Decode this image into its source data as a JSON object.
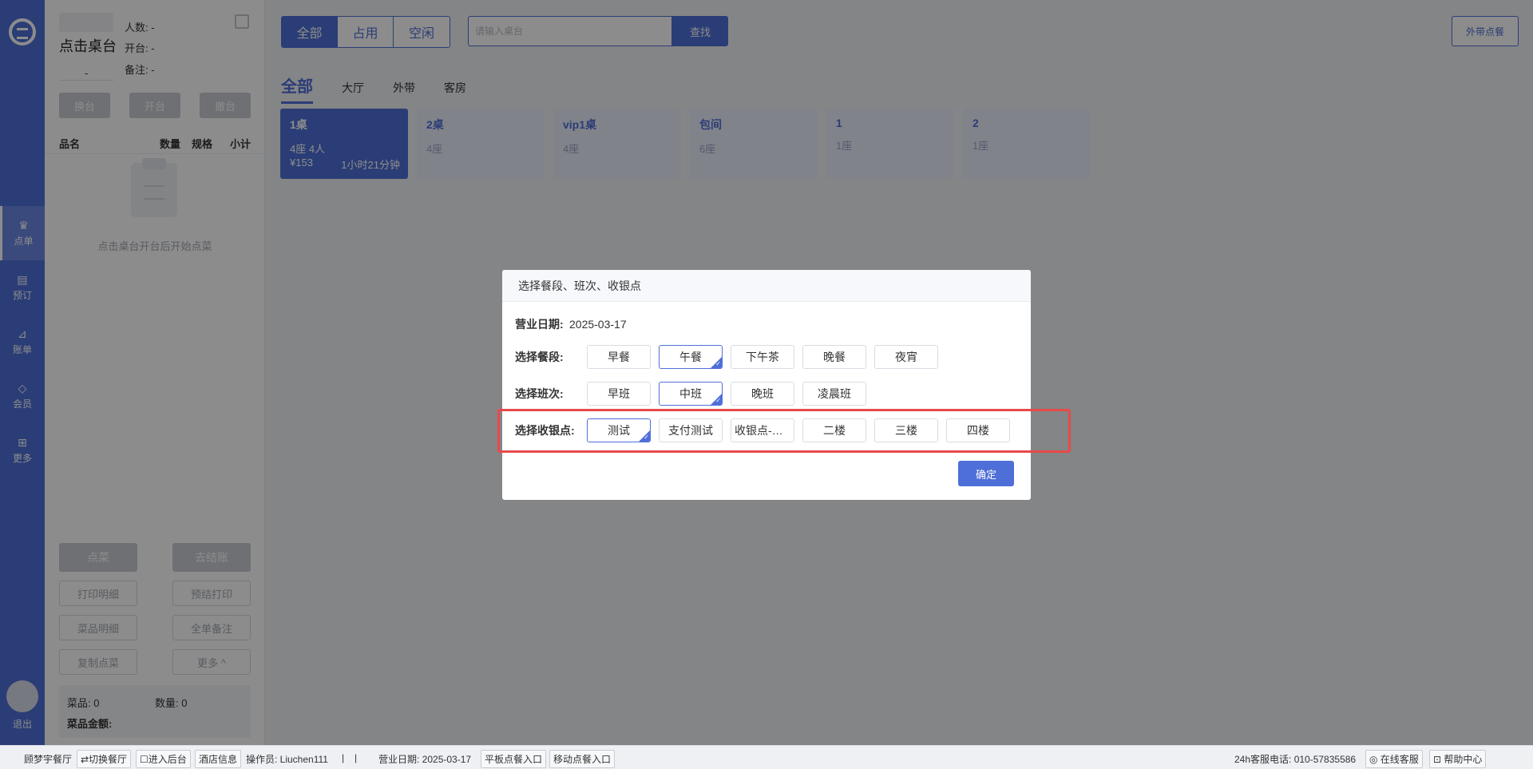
{
  "nav": {
    "items": [
      {
        "label": "点单",
        "icon": "chef-hat-icon"
      },
      {
        "label": "预订",
        "icon": "book-icon"
      },
      {
        "label": "账单",
        "icon": "chart-icon"
      },
      {
        "label": "会员",
        "icon": "diamond-icon"
      },
      {
        "label": "更多",
        "icon": "grid-icon"
      }
    ],
    "logout": "退出"
  },
  "order": {
    "title": "点击桌台",
    "dash": "-",
    "people": "人数: -",
    "open": "开台: -",
    "remark": "备注: -",
    "btns": [
      "换台",
      "开台",
      "撤台"
    ],
    "cols": {
      "name": "品名",
      "qty": "数量",
      "spec": "规格",
      "sub": "小计"
    },
    "empty": "点击桌台开台后开始点菜",
    "order_btn": "点菜",
    "checkout_btn": "去结账",
    "print_detail": "打印明细",
    "pre_print": "预结打印",
    "dish_detail": "菜品明细",
    "all_remark": "全单备注",
    "copy_dish": "复制点菜",
    "more": "更多 ^",
    "dish_count": "菜品:  0",
    "quantity": "数量:  0",
    "amount": "菜品金额:"
  },
  "top": {
    "seg": [
      "全部",
      "占用",
      "空闲"
    ],
    "search_placeholder": "请输入桌台",
    "search_btn": "查找",
    "takeout_btn": "外带点餐"
  },
  "areas": [
    "全部",
    "大厅",
    "外带",
    "客房"
  ],
  "tables": [
    {
      "name": "1桌",
      "seats": "4座   4人",
      "price": "¥153",
      "time": "1小时21分钟"
    },
    {
      "name": "2桌",
      "seats": "4座"
    },
    {
      "name": "vip1桌",
      "seats": "4座"
    },
    {
      "name": "包间",
      "seats": "6座"
    },
    {
      "name": "1",
      "seats": "1座"
    },
    {
      "name": "2",
      "seats": "1座"
    }
  ],
  "modal": {
    "title": "选择餐段、班次、收银点",
    "date_label": "营业日期:",
    "date_value": "2025-03-17",
    "meal_label": "选择餐段:",
    "meals": [
      "早餐",
      "午餐",
      "下午茶",
      "晚餐",
      "夜宵"
    ],
    "shift_label": "选择班次:",
    "shifts": [
      "早班",
      "中班",
      "晚班",
      "凌晨班"
    ],
    "cashier_label": "选择收银点:",
    "cashiers": [
      "测试",
      "支付测试",
      "收银点-消...",
      "二楼",
      "三楼",
      "四楼"
    ],
    "confirm": "确定",
    "selected_meal": "午餐",
    "selected_shift": "中班",
    "selected_cashier": "测试"
  },
  "status": {
    "restaurant": "顾梦宇餐厅",
    "switch": "⇄切换餐厅",
    "backend": "☐进入后台",
    "hotel": "酒店信息",
    "operator": "操作员: Liuchen111",
    "sep1": "|",
    "sep2": "|",
    "biz_date": "营业日期: 2025-03-17",
    "tablet": "平板点餐入口",
    "mobile": "移动点餐入口",
    "hotline": "24h客服电话: 010-57835586",
    "online": "◎ 在线客服",
    "help": "⊡ 帮助中心"
  },
  "colors": {
    "primary": "#4f6fd8",
    "highlight": "#e84a4a"
  }
}
